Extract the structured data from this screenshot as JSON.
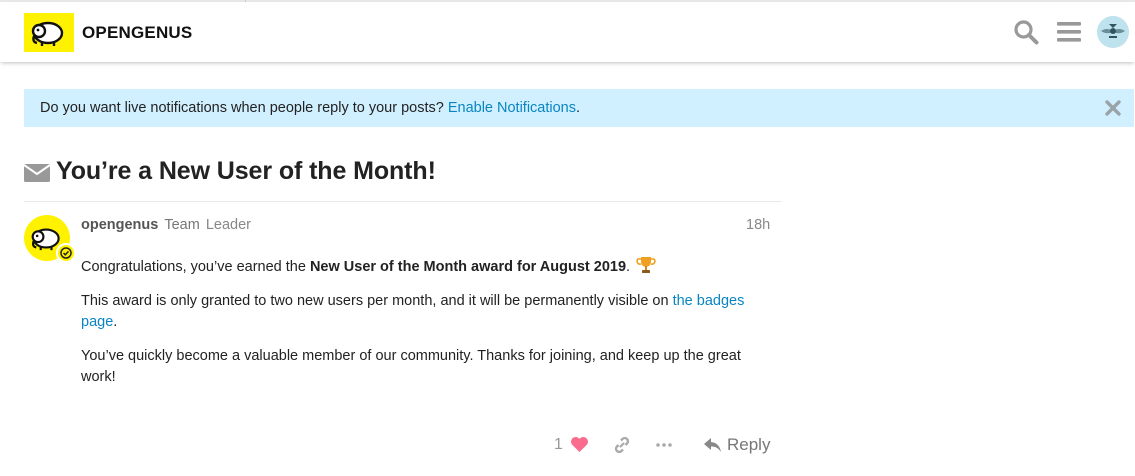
{
  "header": {
    "site_name": "OPENGENUS",
    "icons": [
      "search-icon",
      "hamburger-menu-icon",
      "user-avatar"
    ]
  },
  "banner": {
    "message": "Do you want live notifications when people reply to your posts?",
    "link_text": "Enable Notifications",
    "trailing": ".",
    "close_icon": "close-icon"
  },
  "topic": {
    "icon": "envelope-icon",
    "title": "You’re a New User of the Month!"
  },
  "post": {
    "username": "opengenus",
    "group": "Team",
    "user_title": "Leader",
    "date": "18h",
    "p1_prefix": "Congratulations, you’ve earned the ",
    "p1_bold": "New User of the Month award for August 2019",
    "p1_suffix": ".",
    "p1_icon": "trophy-icon",
    "p2_text": "This award is only granted to two new users per month, and it will be permanently visible on ",
    "p2_link": "the badges page",
    "p2_suffix": ".",
    "p3_text": "You’ve quickly become a valuable member of our community. Thanks for joining, and keep up the great work!"
  },
  "actions": {
    "like_count": "1",
    "reply_label": "Reply"
  },
  "colors": {
    "brand_yellow": "#fff200",
    "banner_bg": "#d1f0ff",
    "link": "#0a85c2",
    "like_heart": "#fa6c8d"
  }
}
